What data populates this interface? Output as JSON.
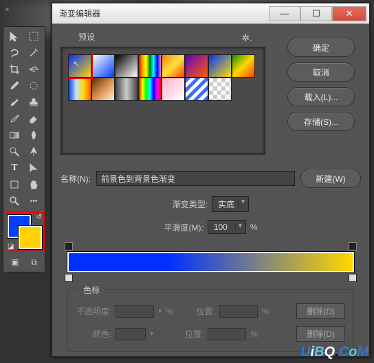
{
  "app": {
    "collapse": "«"
  },
  "dialog": {
    "title": "渐变编辑器",
    "presets_label": "预设",
    "buttons": {
      "ok": "确定",
      "cancel": "取消",
      "load": "载入(L)...",
      "save": "存储(S)..."
    },
    "name_label": "名称(N):",
    "name_value": "前景色到背景色渐变",
    "new_btn": "新建(W)",
    "type_label": "渐变类型:",
    "type_value": "实底",
    "smooth_label": "平滑度(M):",
    "smooth_value": "100",
    "smooth_unit": "%",
    "stops": {
      "legend": "色标",
      "opacity_label": "不透明度:",
      "color_label": "颜色:",
      "position_label": "位置:",
      "percent": "%",
      "delete": "删除(D)"
    }
  },
  "gradient": {
    "from": "#0030ff",
    "to": "#ffd800"
  },
  "watermark": "UiBQ.CoM"
}
